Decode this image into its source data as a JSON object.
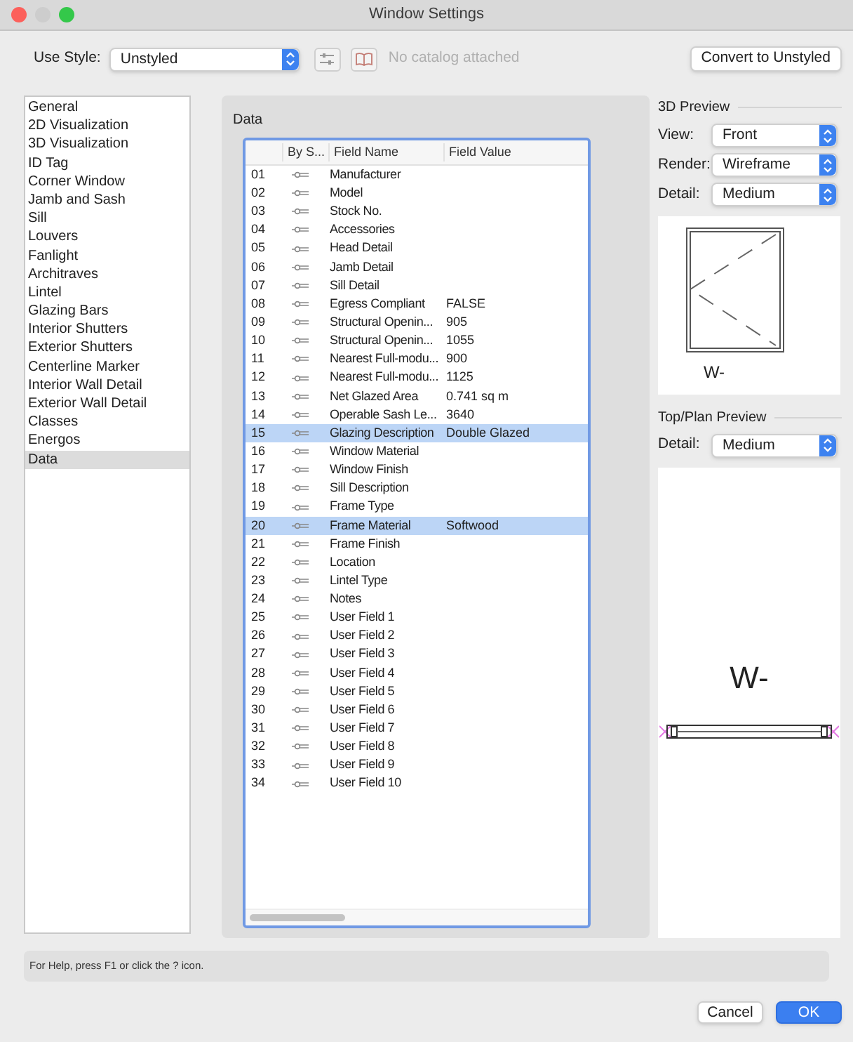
{
  "window": {
    "title": "Window Settings"
  },
  "toolbar": {
    "style_label": "Use Style:",
    "style_value": "Unstyled",
    "catalog_text": "No catalog attached",
    "convert_button": "Convert to Unstyled"
  },
  "sidebar": {
    "items": [
      {
        "label": "General",
        "selected": false
      },
      {
        "label": "2D Visualization",
        "selected": false
      },
      {
        "label": "3D Visualization",
        "selected": false
      },
      {
        "label": "ID Tag",
        "selected": false
      },
      {
        "label": "Corner Window",
        "selected": false
      },
      {
        "label": "Jamb and Sash",
        "selected": false
      },
      {
        "label": "Sill",
        "selected": false
      },
      {
        "label": "Louvers",
        "selected": false
      },
      {
        "label": "Fanlight",
        "selected": false
      },
      {
        "label": "Architraves",
        "selected": false
      },
      {
        "label": "Lintel",
        "selected": false
      },
      {
        "label": "Glazing Bars",
        "selected": false
      },
      {
        "label": "Interior Shutters",
        "selected": false
      },
      {
        "label": "Exterior Shutters",
        "selected": false
      },
      {
        "label": "Centerline Marker",
        "selected": false
      },
      {
        "label": "Interior Wall Detail",
        "selected": false
      },
      {
        "label": "Exterior Wall Detail",
        "selected": false
      },
      {
        "label": "Classes",
        "selected": false
      },
      {
        "label": "Energos",
        "selected": false
      },
      {
        "label": "Data",
        "selected": true
      }
    ]
  },
  "data_panel": {
    "title": "Data",
    "columns": [
      "By S...",
      "Field Name",
      "Field Value"
    ],
    "rows": [
      {
        "number": "01",
        "name": "Manufacturer",
        "selected": false
      },
      {
        "number": "02",
        "name": "Model",
        "selected": false
      },
      {
        "number": "03",
        "name": "Stock No.",
        "selected": false
      },
      {
        "number": "04",
        "name": "Accessories",
        "selected": false
      },
      {
        "number": "05",
        "name": "Head Detail",
        "selected": false
      },
      {
        "number": "06",
        "name": "Jamb Detail",
        "selected": false
      },
      {
        "number": "07",
        "name": "Sill Detail",
        "selected": false
      },
      {
        "number": "08",
        "name": "Egress Compliant",
        "value": "FALSE",
        "selected": false
      },
      {
        "number": "09",
        "name": "Structural Openin...",
        "value": "905",
        "selected": false
      },
      {
        "number": "10",
        "name": "Structural Openin...",
        "value": "1055",
        "selected": false
      },
      {
        "number": "11",
        "name": "Nearest Full-modu...",
        "value": "900",
        "selected": false
      },
      {
        "number": "12",
        "name": "Nearest Full-modu...",
        "value": "1125",
        "selected": false
      },
      {
        "number": "13",
        "name": "Net Glazed Area",
        "value": "0.741 sq m",
        "selected": false
      },
      {
        "number": "14",
        "name": "Operable Sash Le...",
        "value": "3640",
        "selected": false
      },
      {
        "number": "15",
        "name": "Glazing Description",
        "value": "Double Glazed",
        "selected": true
      },
      {
        "number": "16",
        "name": "Window Material",
        "selected": false
      },
      {
        "number": "17",
        "name": "Window Finish",
        "selected": false
      },
      {
        "number": "18",
        "name": "Sill Description",
        "selected": false
      },
      {
        "number": "19",
        "name": "Frame Type",
        "selected": false
      },
      {
        "number": "20",
        "name": "Frame Material",
        "value": "Softwood",
        "selected": true
      },
      {
        "number": "21",
        "name": "Frame Finish",
        "selected": false
      },
      {
        "number": "22",
        "name": "Location",
        "selected": false
      },
      {
        "number": "23",
        "name": "Lintel Type",
        "selected": false
      },
      {
        "number": "24",
        "name": "Notes",
        "selected": false
      },
      {
        "number": "25",
        "name": "User Field 1",
        "selected": false
      },
      {
        "number": "26",
        "name": "User Field 2",
        "selected": false
      },
      {
        "number": "27",
        "name": "User Field 3",
        "selected": false
      },
      {
        "number": "28",
        "name": "User Field 4",
        "selected": false
      },
      {
        "number": "29",
        "name": "User Field 5",
        "selected": false
      },
      {
        "number": "30",
        "name": "User Field 6",
        "selected": false
      },
      {
        "number": "31",
        "name": "User Field 7",
        "selected": false
      },
      {
        "number": "32",
        "name": "User Field 8",
        "selected": false
      },
      {
        "number": "33",
        "name": "User Field 9",
        "selected": false
      },
      {
        "number": "34",
        "name": "User Field 10",
        "selected": false
      }
    ]
  },
  "preview_3d": {
    "title": "3D Preview",
    "controls": [
      {
        "label": "View:",
        "value": "Front"
      },
      {
        "label": "Render:",
        "value": "Wireframe"
      },
      {
        "label": "Detail:",
        "value": "Medium"
      }
    ],
    "tag": "W-"
  },
  "plan_preview": {
    "title": "Top/Plan Preview",
    "controls": [
      {
        "label": "Detail:",
        "value": "Medium"
      }
    ],
    "tag": "W-"
  },
  "status_bar": {
    "text": "For Help, press F1 or click the ? icon."
  },
  "buttons": [
    {
      "label": "Cancel",
      "kind": "secondary"
    },
    {
      "label": "OK",
      "kind": "primary"
    }
  ]
}
